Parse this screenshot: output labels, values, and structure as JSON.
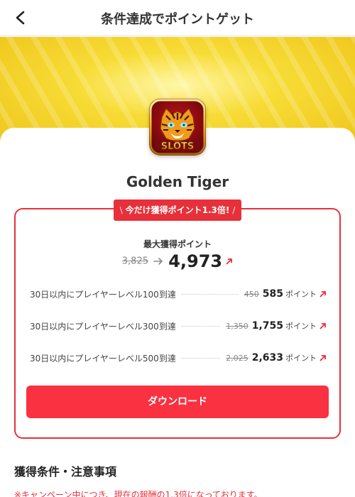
{
  "header": {
    "title": "条件達成でポイントゲット"
  },
  "banner": {
    "background_color": "#f5d32a"
  },
  "app": {
    "name": "Golden Tiger",
    "icon_text": "SLOTS"
  },
  "promo": {
    "badge_prefix": "\\",
    "badge_text": "今だけ獲得ポイント1.3倍!",
    "badge_suffix": "/",
    "accent_color": "#e8303a"
  },
  "max_points": {
    "label": "最大獲得ポイント",
    "old_value": "3,825",
    "new_value": "4,973"
  },
  "conditions": [
    {
      "label": "30日以内にプレイヤーレベル100到達",
      "old_points": "450",
      "new_points": "585",
      "unit": "ポイント"
    },
    {
      "label": "30日以内にプレイヤーレベル300到達",
      "old_points": "1,350",
      "new_points": "1,755",
      "unit": "ポイント"
    },
    {
      "label": "30日以内にプレイヤーレベル500到達",
      "old_points": "2,025",
      "new_points": "2,633",
      "unit": "ポイント"
    }
  ],
  "download_button": {
    "label": "ダウンロード",
    "color": "#fa3140"
  },
  "terms": {
    "title": "獲得条件・注意事項",
    "notice": "※キャンペーン中につき、現在の報酬の1.3倍になっております。"
  }
}
